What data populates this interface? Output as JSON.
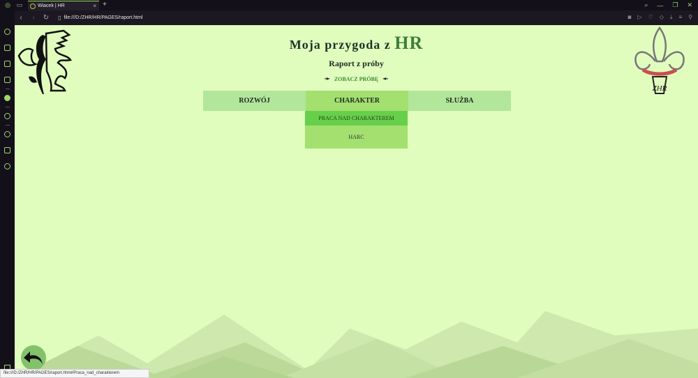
{
  "browser": {
    "tab_title": "Wiacek | HR",
    "new_tab": "+",
    "url": "file:///D:/ZHR/HR/PAGES/raport.html",
    "status_url": "file:///D:/ZHR/HR/PAGES/raport.html#Praca_nad_charakterem"
  },
  "page": {
    "title_text": "Moja przygoda z",
    "title_hr": "HR",
    "subtitle": "Raport z próby",
    "see_proof": "ZOBACZ PRÓBĘ",
    "menu": [
      {
        "label": "ROZWÓJ"
      },
      {
        "label": "CHARAKTER"
      },
      {
        "label": "SŁUŻBA"
      }
    ],
    "dropdown": [
      {
        "label": "PRACA NAD CHARAKTEREM"
      },
      {
        "label": "HARC"
      }
    ],
    "logo_right_text": "ZHR"
  },
  "colors": {
    "page_bg": "#e0fdbd",
    "menu_bg": "#b2e69a",
    "menu_active": "#a4e070",
    "dropdown_hover": "#67d04a",
    "accent": "#3f7d3a"
  }
}
